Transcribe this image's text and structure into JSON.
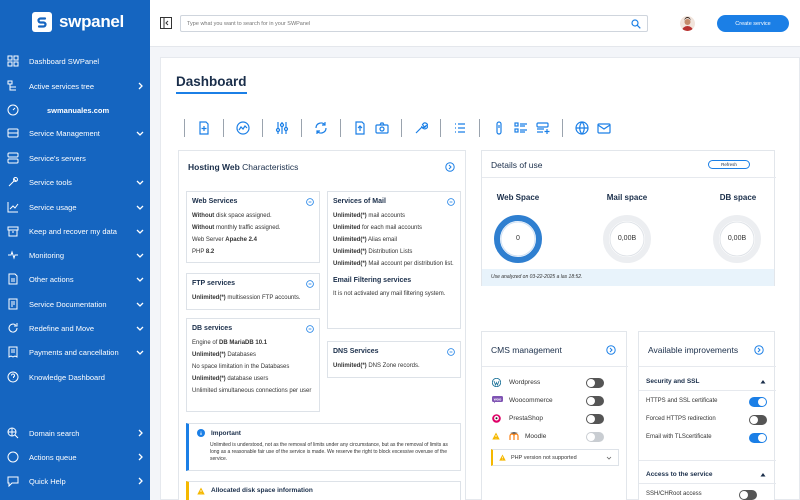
{
  "brand": {
    "name": "swpanel",
    "accent": "#1565c0",
    "button_blue": "#1b7fe6"
  },
  "sidebar": {
    "items": [
      {
        "label": "Dashboard SWPanel",
        "icon": "dashboard-icon",
        "chevron": false
      },
      {
        "label": "Active services tree",
        "icon": "tree-icon",
        "chevron": true
      },
      {
        "label": "swmanuales.com",
        "icon": "gauge-icon",
        "chevron": false,
        "sub": true
      },
      {
        "label": "Service Management",
        "icon": "server-icon",
        "chevron": true
      },
      {
        "label": "Service's servers",
        "icon": "servers-icon",
        "chevron": false
      },
      {
        "label": "Service tools",
        "icon": "tools-icon",
        "chevron": true
      },
      {
        "label": "Service usage",
        "icon": "chart-icon",
        "chevron": true
      },
      {
        "label": "Keep and recover my data",
        "icon": "archive-icon",
        "chevron": true
      },
      {
        "label": "Monitoring",
        "icon": "pulse-icon",
        "chevron": true
      },
      {
        "label": "Other actions",
        "icon": "document-icon",
        "chevron": true
      },
      {
        "label": "Service Documentation",
        "icon": "doc-icon",
        "chevron": true
      },
      {
        "label": "Redefine and Move",
        "icon": "refresh-icon",
        "chevron": true
      },
      {
        "label": "Payments and cancellation",
        "icon": "receipt-icon",
        "chevron": true
      },
      {
        "label": "Knowledge Dashboard",
        "icon": "help-icon",
        "chevron": false
      },
      {
        "label": "Domain search",
        "icon": "domain-search-icon",
        "chevron": true
      },
      {
        "label": "Actions queue",
        "icon": "circle-icon",
        "chevron": true
      },
      {
        "label": "Quick Help",
        "icon": "chat-icon",
        "chevron": true
      }
    ]
  },
  "topbar": {
    "search_placeholder": "Type what you want to search for in your SWPanel",
    "create_label": "Create service"
  },
  "main": {
    "title": "Dashboard"
  },
  "hosting": {
    "title_bold": "Hosting Web",
    "title_rest": " Characteristics",
    "web": {
      "title": "Web Services",
      "l1b": "Without",
      "l1": " disk space assigned.",
      "l2b": "Without",
      "l2": " monthly traffic assigned.",
      "l3": "Web Server ",
      "l3b": "Apache 2.4",
      "l4": "PHP ",
      "l4b": "8.2"
    },
    "ftp": {
      "title": "FTP services",
      "l1b": "Unlimited(*)",
      "l1": " multisession FTP accounts."
    },
    "db": {
      "title": "DB services",
      "l1": "Engine of ",
      "l1b": "DB MariaDB 10.1",
      "l2b": "Unlimited(*)",
      "l2": " Databases",
      "l3": "No space limitation in the Databases",
      "l4b": "Unlimited(*)",
      "l4": " database users",
      "l5": "Unlimited simultaneous connections per user"
    },
    "mail": {
      "title": "Services of Mail",
      "l1b": "Unlimited(*)",
      "l1": " mail accounts",
      "l2b": "Unlimited",
      "l2": " for each mail accounts",
      "l3b": "Unlimited(*)",
      "l3": " Alias email",
      "l4b": "Unlimited(*)",
      "l4": " Distribution Lists",
      "l5b": "Unlimited(*)",
      "l5": " Mail account per distribution list."
    },
    "filter": {
      "title": "Email Filtering services",
      "l1": "It is not activated any mail filtering system."
    },
    "dns": {
      "title": "DNS Services",
      "l1b": "Unlimited(*)",
      "l1": " DNS Zone records."
    },
    "important": {
      "title": "Important",
      "text": "Unlimited is understood, not as the removal of limits under any circumstance, but as the removal of limits as long as a reasonable fair use of the service is made. We reserve the right to block excessive overuse of the service."
    },
    "allocated": {
      "title": "Allocated disk space information"
    }
  },
  "details": {
    "title": "Details of use",
    "refresh": "Refresh",
    "web_label": "Web Space",
    "web_value": "0",
    "mail_label": "Mail space",
    "mail_value": "0,00B",
    "db_label": "DB space",
    "db_value": "0,00B",
    "footnote": "Use analyzed on 03-22-2025 a las 18:52."
  },
  "cms": {
    "title": "CMS management",
    "items": [
      {
        "label": "Wordpress",
        "state": "off"
      },
      {
        "label": "Woocommerce",
        "state": "off"
      },
      {
        "label": "PrestaShop",
        "state": "off"
      },
      {
        "label": "Moodle",
        "state": "disabled"
      }
    ],
    "warning": "PHP version not supported"
  },
  "improvements": {
    "title": "Available improvements",
    "section1": "Security and SSL",
    "items1": [
      {
        "label": "HTTPS and SSL certificate",
        "state": "on"
      },
      {
        "label": "Forced HTTPS redirection",
        "state": "off"
      },
      {
        "label": "Email with TLScertificate",
        "state": "on"
      }
    ],
    "section2": "Access to the service",
    "items2": [
      {
        "label": "SSH/CHRoot access",
        "state": "off"
      }
    ]
  }
}
